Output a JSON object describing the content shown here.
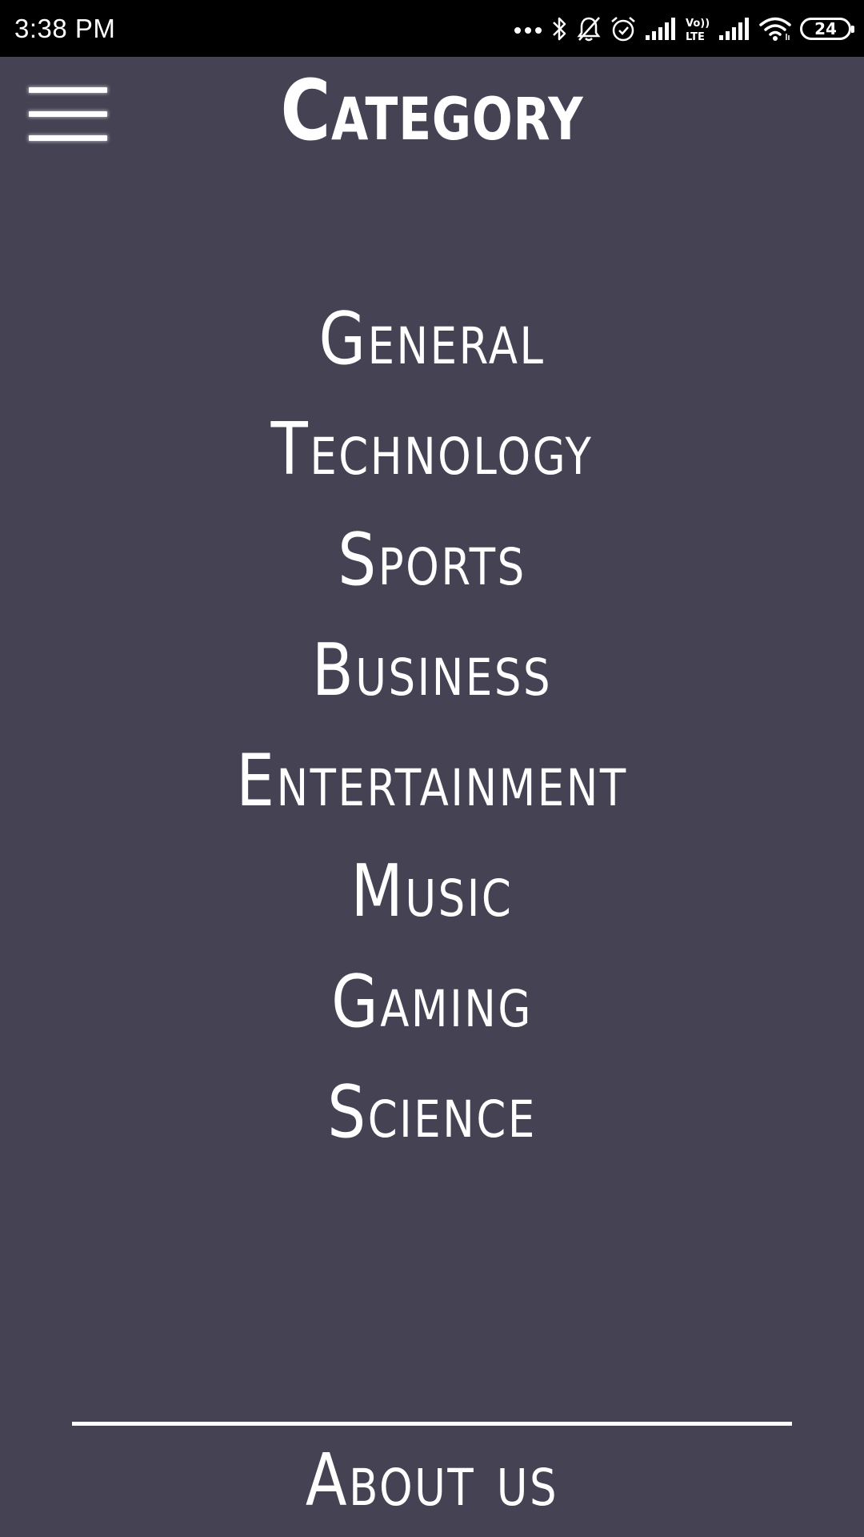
{
  "status_bar": {
    "time": "3:38 PM",
    "battery_level": "24",
    "icons": [
      "more-dots-icon",
      "bluetooth-icon",
      "bell-off-icon",
      "alarm-icon",
      "signal-icon",
      "volte-icon",
      "signal-icon",
      "wifi-icon",
      "battery-icon"
    ],
    "volte_top": "Vo))",
    "volte_bottom": "LTE"
  },
  "header": {
    "menu_icon": "hamburger-menu-icon",
    "title": "Category"
  },
  "categories": [
    {
      "label": "General"
    },
    {
      "label": "Technology"
    },
    {
      "label": "Sports"
    },
    {
      "label": "Business"
    },
    {
      "label": "Entertainment"
    },
    {
      "label": "Music"
    },
    {
      "label": "Gaming"
    },
    {
      "label": "Science"
    }
  ],
  "footer": {
    "about_label": "About us"
  },
  "colors": {
    "background": "#454254",
    "status_bar": "#000000",
    "text": "#ffffff"
  }
}
